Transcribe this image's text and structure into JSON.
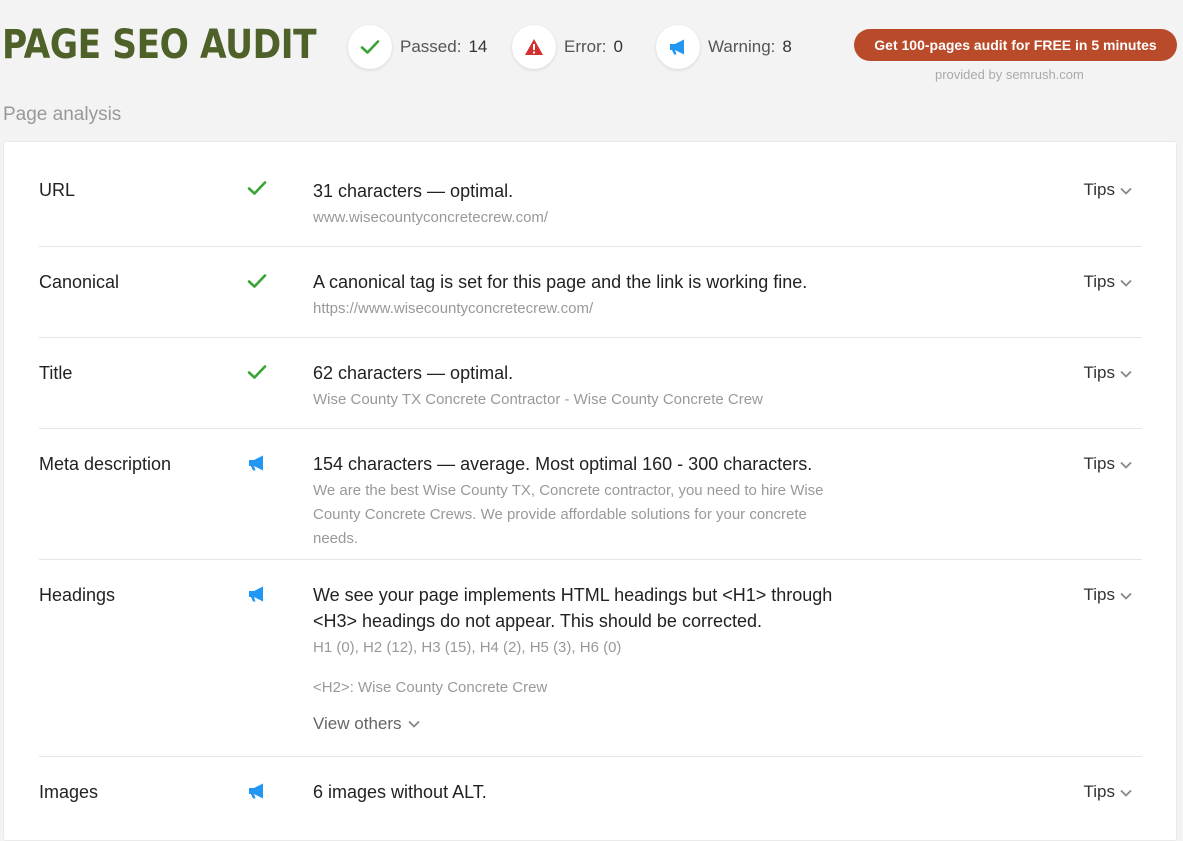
{
  "header": {
    "title": "PAGE SEO AUDIT",
    "stats": {
      "passed": {
        "label": "Passed:",
        "value": "14",
        "icon": "check-icon"
      },
      "error": {
        "label": "Error:",
        "value": "0",
        "icon": "warning-triangle-icon"
      },
      "warning": {
        "label": "Warning:",
        "value": "8",
        "icon": "megaphone-icon"
      }
    },
    "cta_label": "Get 100-pages audit for FREE in 5 minutes",
    "provided_by": "provided by  semrush.com"
  },
  "section_heading": "Page analysis",
  "tips_label": "Tips",
  "colors": {
    "title": "#4e6129",
    "cta": "#b94a2a",
    "pass": "#3aa335",
    "error": "#d32f2f",
    "warning": "#2196f3"
  },
  "rows": [
    {
      "label": "URL",
      "status": "pass",
      "main": "31 characters — optimal.",
      "sub": "www.wisecountyconcretecrew.com/"
    },
    {
      "label": "Canonical",
      "status": "pass",
      "main": "A canonical tag is set for this page and the link is working fine.",
      "sub": "https://www.wisecountyconcretecrew.com/"
    },
    {
      "label": "Title",
      "status": "pass",
      "main": "62 characters — optimal.",
      "sub": "Wise County TX Concrete Contractor - Wise County Concrete Crew"
    },
    {
      "label": "Meta description",
      "status": "warning",
      "main": "154 characters — average. Most optimal 160 - 300 characters.",
      "sub": "We are the best Wise County TX, Concrete contractor, you need to hire Wise County Concrete Crews. We provide affordable solutions for your concrete needs."
    },
    {
      "label": "Headings",
      "status": "warning",
      "main": "We see your page implements HTML headings but <H1> through <H3> headings do not appear. This should be corrected.",
      "sub": "H1 (0), H2 (12), H3 (15), H4 (2), H5 (3), H6 (0)",
      "extra": "<H2>: Wise County Concrete Crew",
      "view_others": "View others"
    },
    {
      "label": "Images",
      "status": "warning",
      "main": "6 images without ALT."
    }
  ]
}
